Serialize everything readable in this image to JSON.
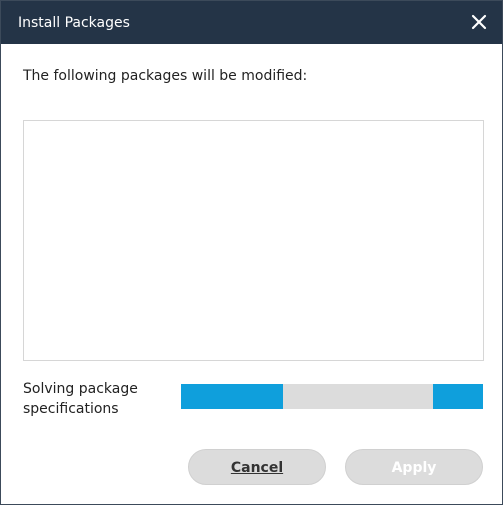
{
  "dialog": {
    "title": "Install Packages",
    "message": "The following packages will be modified:",
    "packages": []
  },
  "status": {
    "text": "Solving package specifications",
    "progress_indeterminate": true
  },
  "buttons": {
    "cancel_label": "Cancel",
    "apply_label": "Apply",
    "apply_enabled": false
  },
  "icons": {
    "close": "close-icon"
  },
  "colors": {
    "titlebar": "#243447",
    "progress_fill": "#0f9fdc",
    "progress_track": "#dcdcdc"
  }
}
